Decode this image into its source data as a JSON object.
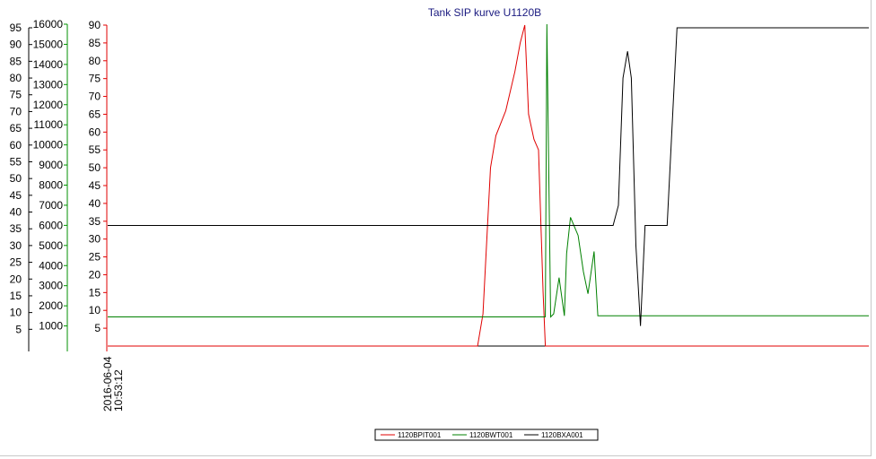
{
  "chart_data": {
    "type": "line",
    "title": "Tank SIP kurve U1120B",
    "x_start_label": [
      "2016-06-04",
      "10:53:12"
    ],
    "axes": [
      {
        "id": "axis_a",
        "color": "#000000",
        "range": [
          0,
          95
        ],
        "ticks": [
          5,
          10,
          15,
          20,
          25,
          30,
          35,
          40,
          45,
          50,
          55,
          60,
          65,
          70,
          75,
          80,
          85,
          90,
          95
        ]
      },
      {
        "id": "axis_b",
        "color": "#009000",
        "range": [
          0,
          16000
        ],
        "ticks": [
          1000,
          2000,
          3000,
          4000,
          5000,
          6000,
          7000,
          8000,
          9000,
          10000,
          11000,
          12000,
          13000,
          14000,
          15000,
          16000
        ]
      },
      {
        "id": "axis_c",
        "color": "#e00000",
        "range": [
          0,
          90
        ],
        "ticks": [
          5,
          10,
          15,
          20,
          25,
          30,
          35,
          40,
          45,
          50,
          55,
          60,
          65,
          70,
          75,
          80,
          85,
          90
        ]
      }
    ],
    "x_range": [
      0,
      1
    ],
    "series": [
      {
        "name": "1120BPIT001",
        "color": "#e00000",
        "x": [
          0,
          0.486,
          0.493,
          0.503,
          0.51,
          0.523,
          0.535,
          0.542,
          0.548,
          0.553,
          0.56,
          0.566,
          0.572,
          0.575,
          0.585,
          0.595,
          0.6,
          1.0
        ],
        "y": [
          0,
          0,
          9,
          50,
          59,
          66,
          77,
          85,
          90,
          65,
          58,
          55,
          15,
          0,
          0,
          0,
          0,
          0
        ]
      },
      {
        "name": "1120BWT001",
        "color": "#008000",
        "x": [
          0,
          0.575,
          0.577,
          0.582,
          0.586,
          0.593,
          0.6,
          0.603,
          0.608,
          0.618,
          0.625,
          0.631,
          0.639,
          0.644,
          0.649,
          0.653,
          0.657,
          0.661,
          0.665,
          1.0
        ],
        "y": [
          1450,
          1450,
          16000,
          1450,
          1600,
          3400,
          1500,
          4600,
          6400,
          5500,
          3700,
          2600,
          4700,
          1500,
          1500,
          1500,
          1500,
          1500,
          1500,
          1500
        ]
      },
      {
        "name": "1120BXA001",
        "color": "#000000",
        "x": [
          0,
          0.664,
          0.671,
          0.677,
          0.683,
          0.688,
          0.694,
          0.7,
          0.706,
          0.71,
          0.713,
          0.716,
          0.72,
          0.727,
          0.735,
          0.748,
          1.0
        ],
        "y": [
          36,
          36,
          42,
          80,
          88,
          80,
          30,
          6,
          36,
          36,
          36,
          36,
          36,
          36,
          36,
          95,
          95
        ]
      }
    ],
    "legend_position": "bottom-center",
    "grid": false
  }
}
